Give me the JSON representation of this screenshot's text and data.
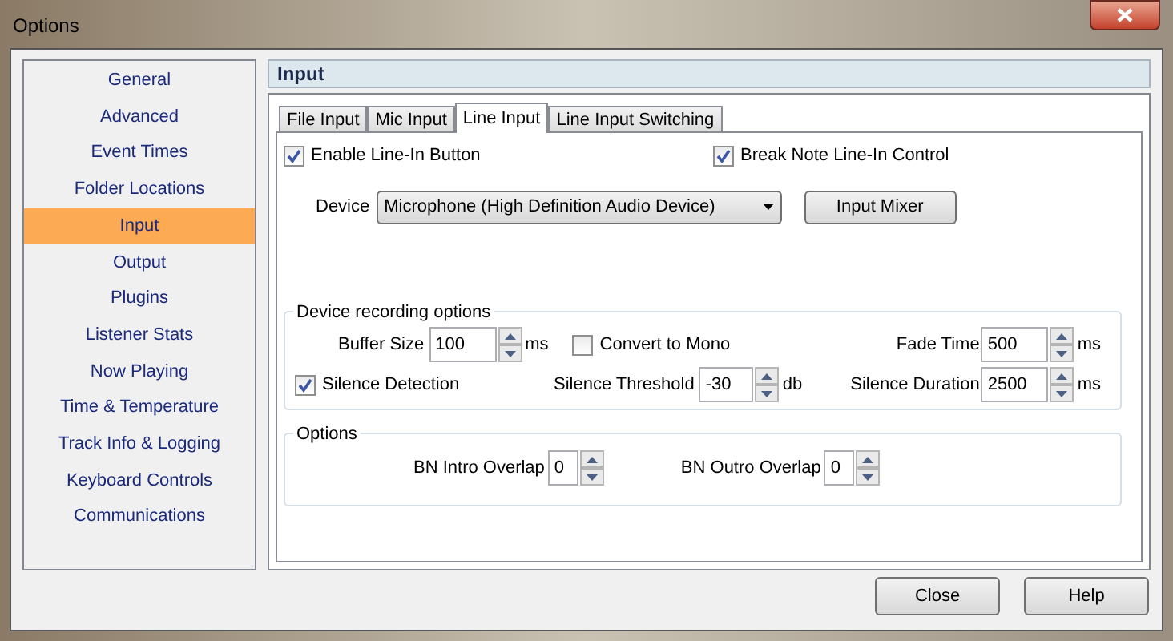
{
  "window": {
    "title": "Options"
  },
  "sidebar": {
    "items": [
      {
        "label": "General",
        "selected": false
      },
      {
        "label": "Advanced",
        "selected": false
      },
      {
        "label": "Event Times",
        "selected": false
      },
      {
        "label": "Folder Locations",
        "selected": false
      },
      {
        "label": "Input",
        "selected": true
      },
      {
        "label": "Output",
        "selected": false
      },
      {
        "label": "Plugins",
        "selected": false
      },
      {
        "label": "Listener Stats",
        "selected": false
      },
      {
        "label": "Now Playing",
        "selected": false
      },
      {
        "label": "Time & Temperature",
        "selected": false
      },
      {
        "label": "Track Info & Logging",
        "selected": false
      },
      {
        "label": "Keyboard Controls",
        "selected": false
      },
      {
        "label": "Communications",
        "selected": false
      }
    ]
  },
  "section_title": "Input",
  "tabs": [
    {
      "label": "File Input",
      "selected": false
    },
    {
      "label": "Mic Input",
      "selected": false
    },
    {
      "label": "Line Input",
      "selected": true
    },
    {
      "label": "Line Input Switching",
      "selected": false
    }
  ],
  "enable_line_in": {
    "label": "Enable Line-In Button",
    "checked": true
  },
  "break_note": {
    "label": "Break Note Line-In Control",
    "checked": true
  },
  "device": {
    "label": "Device",
    "value": "Microphone (High Definition Audio Device)"
  },
  "input_mixer_button": "Input Mixer",
  "recording_group": {
    "title": "Device recording options",
    "buffer_size": {
      "label": "Buffer Size",
      "value": "100",
      "unit": "ms"
    },
    "convert_to_mono": {
      "label": "Convert to Mono",
      "checked": false
    },
    "fade_time": {
      "label": "Fade Time",
      "value": "500",
      "unit": "ms"
    },
    "silence_detection": {
      "label": "Silence Detection",
      "checked": true
    },
    "silence_threshold": {
      "label": "Silence Threshold",
      "value": "-30",
      "unit": "db"
    },
    "silence_duration": {
      "label": "Silence Duration",
      "value": "2500",
      "unit": "ms"
    }
  },
  "options_group": {
    "title": "Options",
    "intro_overlap": {
      "label": "BN Intro Overlap",
      "value": "0"
    },
    "outro_overlap": {
      "label": "BN Outro Overlap",
      "value": "0"
    }
  },
  "buttons": [
    "Close",
    "Help"
  ]
}
